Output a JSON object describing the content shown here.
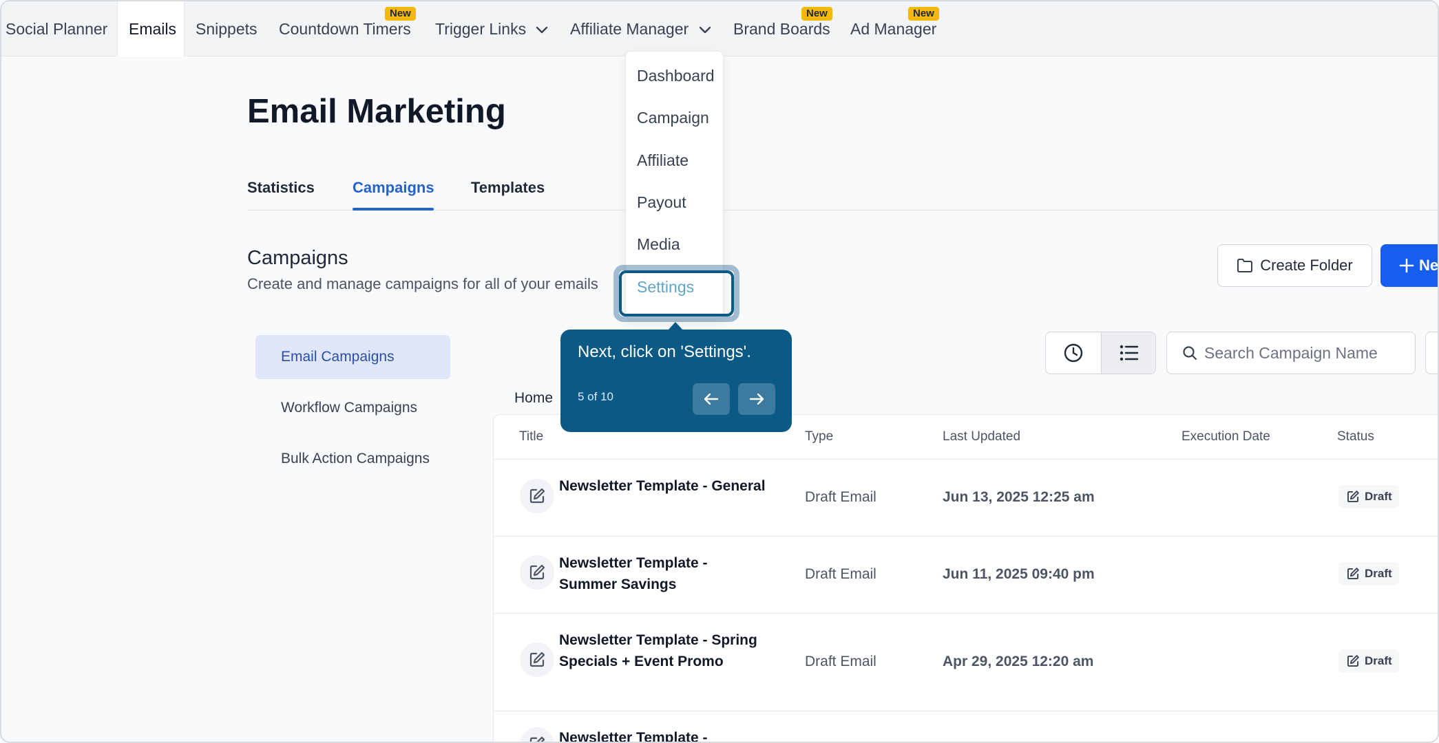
{
  "nav": {
    "items": [
      {
        "label": "Social Planner"
      },
      {
        "label": "Emails"
      },
      {
        "label": "Snippets"
      },
      {
        "label": "Countdown Timers",
        "badge": "New"
      },
      {
        "label": "Trigger Links"
      },
      {
        "label": "Affiliate Manager"
      },
      {
        "label": "Brand Boards",
        "badge": "New"
      },
      {
        "label": "Ad Manager",
        "badge": "New"
      }
    ]
  },
  "dropdown": {
    "items": [
      "Dashboard",
      "Campaign",
      "Affiliate",
      "Payout",
      "Media",
      "Settings"
    ]
  },
  "tooltip": {
    "text": "Next, click on 'Settings'.",
    "step": "5 of 10"
  },
  "page": {
    "title": "Email Marketing",
    "tabs": [
      "Statistics",
      "Campaigns",
      "Templates"
    ]
  },
  "section": {
    "title": "Campaigns",
    "subtitle": "Create and manage campaigns for all of your emails",
    "create_folder": "Create Folder",
    "new_label": "Ne"
  },
  "subnav": [
    "Email Campaigns",
    "Workflow Campaigns",
    "Bulk Action Campaigns"
  ],
  "search": {
    "placeholder": "Search Campaign Name"
  },
  "breadcrumb": "Home",
  "table": {
    "headers": [
      "Title",
      "Type",
      "Last Updated",
      "Execution Date",
      "Status"
    ],
    "rows": [
      {
        "title": "Newsletter Template - General",
        "type": "Draft Email",
        "updated": "Jun 13, 2025 12:25 am",
        "status": "Draft"
      },
      {
        "title": "Newsletter Template - Summer Savings",
        "type": "Draft Email",
        "updated": "Jun 11, 2025 09:40 pm",
        "status": "Draft"
      },
      {
        "title": "Newsletter Template - Spring Specials + Event Promo",
        "type": "Draft Email",
        "updated": "Apr 29, 2025 12:20 am",
        "status": "Draft"
      },
      {
        "title": "Newsletter Template -",
        "type": "",
        "updated": "",
        "status": ""
      }
    ]
  },
  "colors": {
    "accent": "#2563c9",
    "primary_button": "#155eef",
    "tooltip": "#0b5a85",
    "badge": "#f5b70a"
  }
}
